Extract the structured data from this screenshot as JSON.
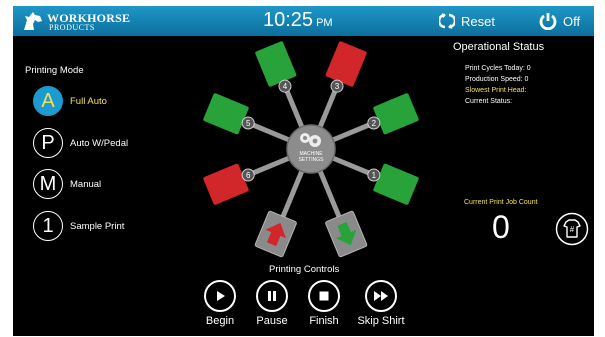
{
  "header": {
    "logo_line1": "WORKHORSE",
    "logo_line2": "PRODUCTS",
    "time": "10:25",
    "ampm": "PM",
    "reset_label": "Reset",
    "off_label": "Off"
  },
  "printing_mode": {
    "title": "Printing Mode",
    "options": [
      {
        "symbol": "A",
        "label": "Full Auto",
        "active": true
      },
      {
        "symbol": "P",
        "label": "Auto W/Pedal",
        "active": false
      },
      {
        "symbol": "M",
        "label": "Manual",
        "active": false
      },
      {
        "symbol": "1",
        "label": "Sample Print",
        "active": false
      }
    ]
  },
  "machine": {
    "hub_label_1": "MACHINE",
    "hub_label_2": "SETTINGS",
    "stations": [
      {
        "number": "1",
        "status": "green"
      },
      {
        "number": "2",
        "status": "green"
      },
      {
        "number": "3",
        "status": "red"
      },
      {
        "number": "4",
        "status": "green"
      },
      {
        "number": "5",
        "status": "green"
      },
      {
        "number": "6",
        "status": "red"
      },
      {
        "number": "",
        "status": "unload"
      },
      {
        "number": "",
        "status": "load"
      }
    ],
    "colors": {
      "green": "#27a33a",
      "red": "#d1262a",
      "platen_gray": "#8a8a8a",
      "arm": "#9a9a9a"
    }
  },
  "operational_status": {
    "title": "Operational Status",
    "print_cycles": "Print Cycles Today: 0",
    "production_speed": "Production Speed: 0",
    "slowest_head": "Slowest Print Head:",
    "current_status": "Current Status:",
    "job_count_title": "Current Print Job Count",
    "job_count_value": "0",
    "shirt_icon_label": "#"
  },
  "controls": {
    "title": "Printing Controls",
    "begin": "Begin",
    "pause": "Pause",
    "finish": "Finish",
    "skip": "Skip Shirt"
  },
  "theme": {
    "accent": "#1d9ad0",
    "highlight": "#f3e15b",
    "topbar": "#1284b5"
  }
}
